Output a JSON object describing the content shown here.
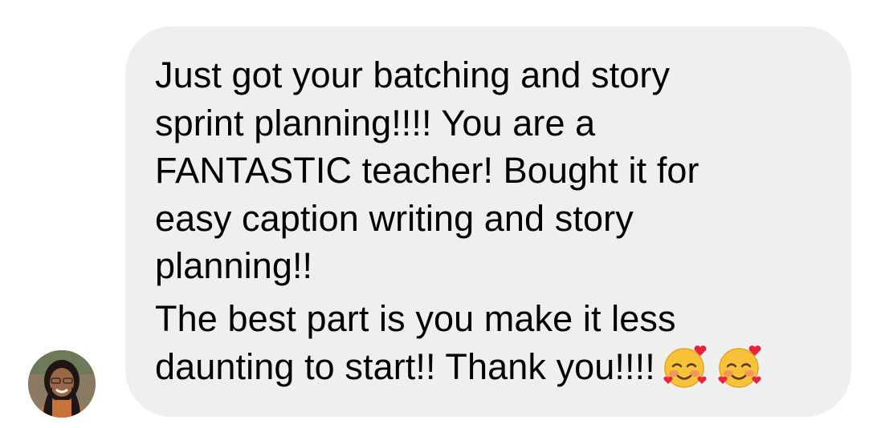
{
  "message": {
    "lines": [
      "Just got your batching and story",
      "sprint planning!!!! You are a",
      "FANTASTIC teacher! Bought it for",
      "easy caption writing and story",
      "planning!!",
      "The best part is you make it less",
      "daunting to start!! Thank you!!!!"
    ],
    "emojis": [
      "smiling-face-with-hearts",
      "smiling-face-with-hearts"
    ],
    "bubble_color": "#efefef",
    "text_color": "#000000"
  },
  "sender": {
    "avatar": "avatar-photo"
  }
}
